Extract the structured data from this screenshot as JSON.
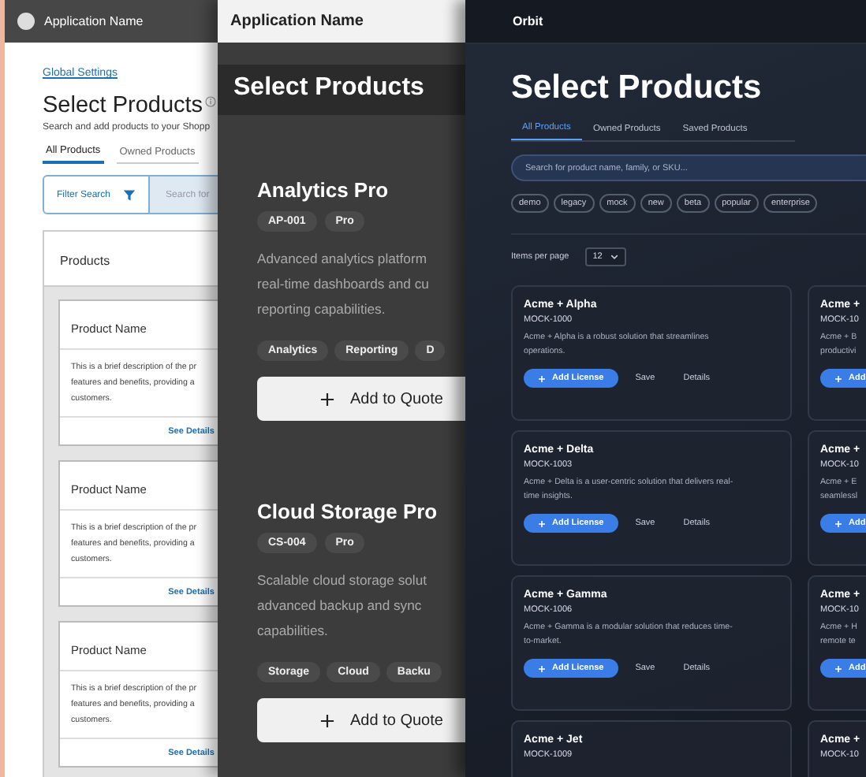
{
  "light_screen": {
    "app_name": "Application Name",
    "breadcrumb": "Global Settings",
    "title": "Select Products",
    "subtitle": "Search and add products to your Shopp",
    "tabs": [
      {
        "label": "All Products",
        "selected": true
      },
      {
        "label": "Owned Products",
        "selected": false
      }
    ],
    "filter_button": "Filter Search",
    "search": {
      "placeholder": "Search for"
    },
    "panel_title": "Products",
    "cards": [
      {
        "name": "Product Name",
        "description_lines": [
          "This is a brief description of the pr",
          "features and benefits, providing a",
          "customers."
        ],
        "link": "See Details"
      },
      {
        "name": "Product Name",
        "description_lines": [
          "This is a brief description of the pr",
          "features and benefits, providing a",
          "customers."
        ],
        "link": "See Details"
      },
      {
        "name": "Product Name",
        "description_lines": [
          "This is a brief description of the pr",
          "features and benefits, providing a",
          "customers."
        ],
        "link": "See Details"
      }
    ]
  },
  "grey_screen": {
    "app_name": "Application Name",
    "title": "Select Products",
    "products": [
      {
        "name": "Analytics Pro",
        "badges": [
          "AP-001",
          "Pro"
        ],
        "description_lines": [
          "Advanced analytics platform",
          "real-time dashboards and cu",
          "reporting capabilities."
        ],
        "tags": [
          "Analytics",
          "Reporting",
          "D"
        ],
        "button": "Add to Quote"
      },
      {
        "name": "Cloud Storage Pro",
        "badges": [
          "CS-004",
          "Pro"
        ],
        "description_lines": [
          "Scalable cloud storage solut",
          "advanced backup and sync",
          "capabilities."
        ],
        "tags": [
          "Storage",
          "Cloud",
          "Backu"
        ],
        "button": "Add to Quote"
      }
    ]
  },
  "dark_screen": {
    "brand": "Orbit",
    "title": "Select Products",
    "tabs": [
      {
        "label": "All Products",
        "selected": true
      },
      {
        "label": "Owned Products",
        "selected": false
      },
      {
        "label": "Saved Products",
        "selected": false
      }
    ],
    "search": {
      "placeholder": "Search for product name, family, or SKU..."
    },
    "chips": [
      "demo",
      "legacy",
      "mock",
      "new",
      "beta",
      "popular",
      "enterprise"
    ],
    "items_per_page": {
      "label": "Items per page",
      "value": "12"
    },
    "cards": [
      {
        "name": "Acme + Alpha",
        "sku": "MOCK-1000",
        "description": "Acme + Alpha is a robust solution that streamlines operations.",
        "add_button": "Add License",
        "save": "Save",
        "details": "Details"
      },
      {
        "name": "Acme +",
        "sku": "MOCK-10",
        "description_lines": [
          "Acme + B",
          "productivi"
        ],
        "add_button": "Add"
      },
      {
        "name": "Acme + Delta",
        "sku": "MOCK-1003",
        "description": "Acme + Delta is a user-centric solution that delivers real-time insights.",
        "add_button": "Add License",
        "save": "Save",
        "details": "Details"
      },
      {
        "name": "Acme +",
        "sku": "MOCK-10",
        "description_lines": [
          "Acme + E",
          "seamlessl"
        ],
        "add_button": "Add"
      },
      {
        "name": "Acme + Gamma",
        "sku": "MOCK-1006",
        "description": "Acme + Gamma is a modular solution that reduces time-to-market.",
        "add_button": "Add License",
        "save": "Save",
        "details": "Details"
      },
      {
        "name": "Acme +",
        "sku": "MOCK-10",
        "description_lines": [
          "Acme + H",
          "remote te"
        ],
        "add_button": "Add"
      },
      {
        "name": "Acme + Jet",
        "sku": "MOCK-1009"
      },
      {
        "name": "Acme +",
        "sku": "MOCK-10"
      }
    ]
  }
}
